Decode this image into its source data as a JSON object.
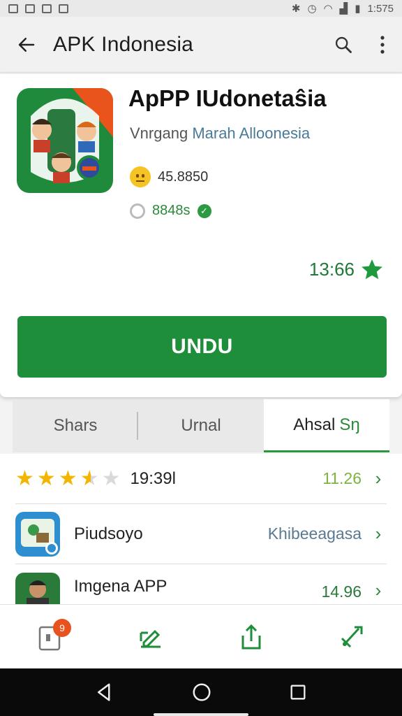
{
  "status_bar": {
    "time": "1:575"
  },
  "appbar": {
    "title": "APK Indonesia"
  },
  "app": {
    "name": "ApPP IUdonetaŝia",
    "developer_prefix": "Vnrgang",
    "developer_link": "Marah Alloonesia",
    "meta1": "45.8850",
    "meta2": "8848s",
    "rating": "13:66"
  },
  "install_label": "UNDU",
  "tabs": [
    {
      "label": "Shars"
    },
    {
      "label": "Urnal"
    },
    {
      "label": "Ahsal",
      "highlight": "Sŋ"
    }
  ],
  "rows": [
    {
      "type": "rating",
      "stars": 3.5,
      "text": "19:39l",
      "value": "11.26"
    },
    {
      "type": "app",
      "text": "Piudsoyo",
      "value": "Khibeeagasa"
    },
    {
      "type": "app",
      "text": "Imgena APP",
      "value": "14.96"
    }
  ],
  "bottom_nav": {
    "badge": "9"
  },
  "colors": {
    "accent": "#1e8e3a",
    "star": "#f4b400"
  }
}
